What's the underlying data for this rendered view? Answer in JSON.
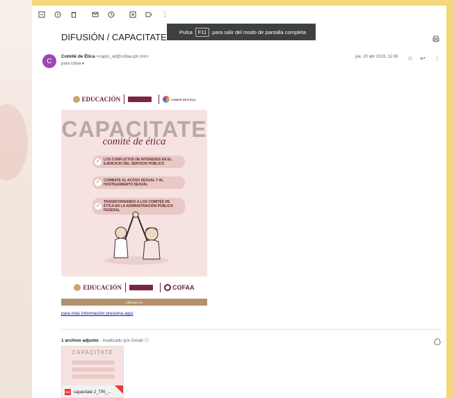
{
  "toolbar": {
    "icons": [
      "archive-icon",
      "report-spam-icon",
      "delete-icon",
      "mark-unread-icon",
      "snooze-icon",
      "add-to-tasks-icon",
      "label-icon",
      "more-vert-icon"
    ]
  },
  "toast": {
    "before": "Pulsa",
    "key": "F11",
    "after": "para salir del modo de pantalla completa"
  },
  "email": {
    "subject": "DIFUSIÓN / CAPACITATE",
    "avatar_letter": "C",
    "avatar_color": "#9c47b7",
    "sender_name": "Comité de Ética",
    "sender_email": "<capci_at@cofaa.ipn.mx>",
    "to_line": "para cofaa ▾",
    "date": "jue, 20 abr 2023, 11:06"
  },
  "poster": {
    "logo_educacion": "EDUCACIÓN",
    "logo_comite": "COMITÉ DE ÉTICA",
    "title": "CAPACITATE",
    "subtitle": "comité de ética",
    "items": [
      "LOS CONFLICTOS DE INTERESES EN EL EJERCICIO DEL SERVICIO PÚBLICO",
      "COMBATE AL ACOSO SEXUAL Y AL HOSTIGAMIENTO SEXUAL",
      "TRANSFORMANDO A LOS COMITÉS DE ÉTICA EN LA ADMINISTRACIÓN PÚBLICA FEDERAL"
    ],
    "logo_cofaa": "COFAA",
    "footer": "cofaa.ipn.mx"
  },
  "body": {
    "more_info_link": "para más información presiona aquí"
  },
  "attachments": {
    "count_label": "1 archivo adjunto",
    "scanned_label": "· Analizado por Gmail ⓘ",
    "file_name": "capacitate 2_TRI_...",
    "thumb_title": "CAPACITATE"
  }
}
